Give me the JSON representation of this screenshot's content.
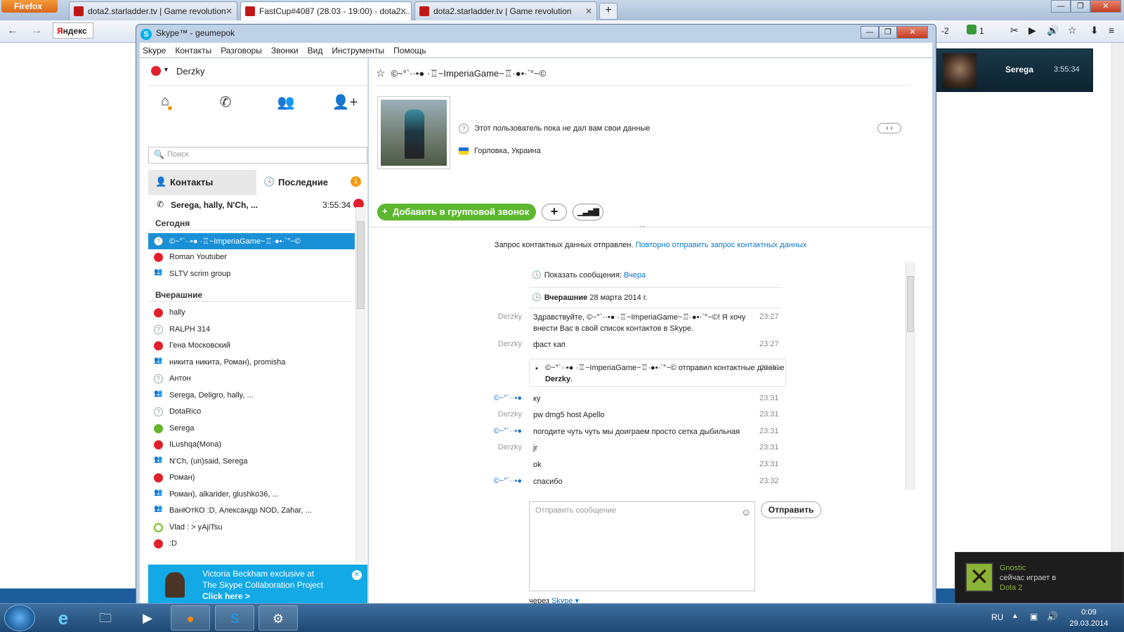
{
  "firefox": {
    "menu": "Firefox",
    "tabs": [
      {
        "title": "dota2.starladder.tv | Game revolution"
      },
      {
        "title": "FastCup#4087 (28.03 - 19:00) - dota2...."
      },
      {
        "title": "dota2.starladder.tv | Game revolution"
      }
    ],
    "new_tab": "+",
    "nav": {
      "search_brand_a": "Я",
      "search_brand_b": "ндекс",
      "counter1": "2",
      "counter2": "1"
    }
  },
  "skype": {
    "title": "Skype™ - geumepok",
    "menu": [
      "Skype",
      "Контакты",
      "Разговоры",
      "Звонки",
      "Вид",
      "Инструменты",
      "Помощь"
    ],
    "user": "Derzky",
    "search_placeholder": "Поиск",
    "tabs": {
      "contacts": "Контакты",
      "recent": "Последние",
      "recent_badge": "1"
    },
    "active_call": {
      "name": "Serega, hally, N'Ch, ...",
      "time": "3:55:34"
    },
    "sections": {
      "today": "Сегодня",
      "yesterday": "Вчерашние"
    },
    "contacts_today": [
      {
        "name": "©~°`··•● ·♖~ImperiaGame~♖·●•·`°~©",
        "selected": true
      },
      {
        "name": "Roman Youtuber"
      },
      {
        "name": "SLTV scrim group"
      }
    ],
    "contacts_yesterday": [
      {
        "name": "hally"
      },
      {
        "name": "RALPH 314"
      },
      {
        "name": "Гена Московский"
      },
      {
        "name": "никита никита, Роман), promisha"
      },
      {
        "name": "Антон"
      },
      {
        "name": "Serega, Deligro, hally, ..."
      },
      {
        "name": "DotaRico"
      },
      {
        "name": "Serega"
      },
      {
        "name": "ILushqa(Mona)"
      },
      {
        "name": "N'Ch, (un)said, Serega"
      },
      {
        "name": "Роман)"
      },
      {
        "name": "Роман), alkarider, glushko36, ..."
      },
      {
        "name": "ВанЮтКО :D, Александр  NOD, Zahar, ..."
      },
      {
        "name": "Vlad : > yAjiTsu"
      },
      {
        "name": ":D"
      }
    ],
    "ad": {
      "line1": "Victoria Beckham exclusive at",
      "line2": "The Skype Collaboration Project",
      "cta": "Click here >"
    },
    "chat": {
      "header": "©~°`··•● ·♖~ImperiaGame~♖·●•·`°~©",
      "info_status": "Этот пользователь пока не дал вам свои данные",
      "info_location": "Горловка, Украина",
      "add_group_call": "Добавить в групповой звонок",
      "plus": "+",
      "request_text": "Запрос контактных данных отправлен.",
      "request_link": "Повторно отправить запрос контактных данных",
      "show_messages": "Показать сообщения:",
      "show_messages_link": "Вчера",
      "day_bold": "Вчерашние",
      "day_date": "28 марта 2014 г.",
      "msgs": [
        {
          "who": "Derzky",
          "me": false,
          "text": "Здравствуйте, ©~°`··•● ·♖~ImperiaGame~♖·●•·`°~©! Я хочу внести Вас в свой список контактов в Skype.",
          "time": "23:27"
        },
        {
          "who": "Derzky",
          "me": false,
          "text": "фаст кап",
          "time": "23:27"
        },
        {
          "who": "©~°`··•●",
          "me": true,
          "text": "ку",
          "time": "23:31"
        },
        {
          "who": "Derzky",
          "me": false,
          "text": "pw dmg5 host Apello",
          "time": "23:31"
        },
        {
          "who": "©~°`··•●",
          "me": true,
          "text": "погодите чуть чуть мы доиграем просто сетка дыбильная",
          "time": "23:31"
        },
        {
          "who": "Derzky",
          "me": false,
          "text": "jr",
          "time": "23:31"
        },
        {
          "who": "",
          "me": false,
          "text": "ok",
          "time": "23:31"
        },
        {
          "who": "©~°`··•●",
          "me": true,
          "text": "спасибо",
          "time": "23:32"
        }
      ],
      "system_msg_a": "©~°`··•● ·♖~ImperiaGame~♖·●•·`°~©",
      "system_msg_b": " отправил контактные данные ",
      "system_msg_c": "Derzky",
      "system_time": "23:31",
      "compose_placeholder": "Отправить сообщение",
      "send": "Отправить",
      "via": "через",
      "via_link": "Skype ▾"
    }
  },
  "call_popup": {
    "name": "Serega",
    "time": "3:55:34"
  },
  "steam_popup": {
    "name": "Gnostic",
    "line2": "сейчас играет в",
    "game": "Dota 2"
  },
  "taskbar": {
    "lang": "RU",
    "time": "0:09",
    "date": "29.03.2014"
  }
}
